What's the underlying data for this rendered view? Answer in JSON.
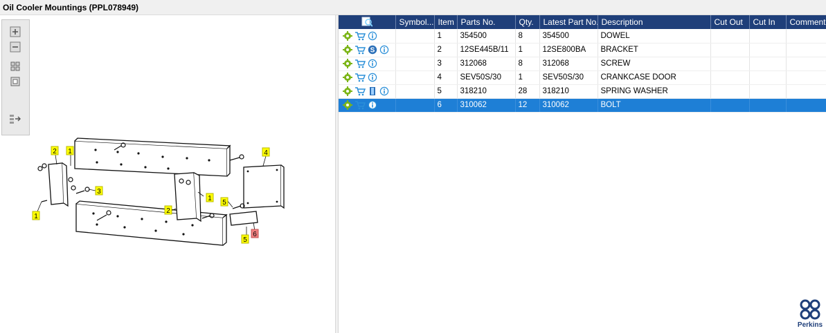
{
  "window": {
    "title": "Oil Cooler Mountings (PPL078949)"
  },
  "toolbox": {
    "tools": [
      "zoom-in-icon",
      "zoom-out-icon",
      "fit-grid-icon",
      "actual-size-icon",
      "export-icon"
    ]
  },
  "diagram": {
    "callouts": [
      {
        "label": "2",
        "style": "yellow"
      },
      {
        "label": "1",
        "style": "yellow"
      },
      {
        "label": "3",
        "style": "yellow"
      },
      {
        "label": "1",
        "style": "yellow"
      },
      {
        "label": "4",
        "style": "yellow"
      },
      {
        "label": "2",
        "style": "yellow"
      },
      {
        "label": "1",
        "style": "yellow"
      },
      {
        "label": "5",
        "style": "yellow"
      },
      {
        "label": "5",
        "style": "yellow"
      },
      {
        "label": "6",
        "style": "red"
      }
    ],
    "colors": {
      "yellow": "#ffff00",
      "red": "#f08080"
    }
  },
  "parts_table": {
    "columns": [
      "",
      "Symbol...",
      "Item",
      "Parts No.",
      "Qty.",
      "Latest Part No.",
      "Description",
      "Cut Out",
      "Cut In",
      "Comment"
    ],
    "rows": [
      {
        "icons": [
          "gear-icon",
          "cart-icon",
          "info-icon"
        ],
        "symbol": "",
        "item": "1",
        "part_no": "354500",
        "qty": "8",
        "latest": "354500",
        "description": "DOWEL",
        "cut_out": "",
        "cut_in": "",
        "comment": ""
      },
      {
        "icons": [
          "gear-icon",
          "cart-icon",
          "s-badge-icon",
          "info-icon"
        ],
        "symbol": "",
        "item": "2",
        "part_no": "12SE445B/11",
        "qty": "1",
        "latest": "12SE800BA",
        "description": "BRACKET",
        "cut_out": "",
        "cut_in": "",
        "comment": ""
      },
      {
        "icons": [
          "gear-icon",
          "cart-icon",
          "info-icon"
        ],
        "symbol": "",
        "item": "3",
        "part_no": "312068",
        "qty": "8",
        "latest": "312068",
        "description": "SCREW",
        "cut_out": "",
        "cut_in": "",
        "comment": ""
      },
      {
        "icons": [
          "gear-icon",
          "cart-icon",
          "info-icon"
        ],
        "symbol": "",
        "item": "4",
        "part_no": "SEV50S/30",
        "qty": "1",
        "latest": "SEV50S/30",
        "description": "CRANKCASE DOOR",
        "cut_out": "",
        "cut_in": "",
        "comment": ""
      },
      {
        "icons": [
          "gear-icon",
          "cart-icon",
          "book-icon",
          "info-icon"
        ],
        "symbol": "",
        "item": "5",
        "part_no": "318210",
        "qty": "28",
        "latest": "318210",
        "description": "SPRING WASHER",
        "cut_out": "",
        "cut_in": "",
        "comment": ""
      },
      {
        "icons": [
          "gear-icon",
          "cart-icon",
          "info-icon"
        ],
        "symbol": "",
        "item": "6",
        "part_no": "310062",
        "qty": "12",
        "latest": "310062",
        "description": "BOLT",
        "cut_out": "",
        "cut_in": "",
        "comment": "",
        "selected": true
      }
    ],
    "colors": {
      "header": "#1f3f7a",
      "selected": "#1e7fd6"
    }
  },
  "branding": {
    "name": "Perkins"
  }
}
